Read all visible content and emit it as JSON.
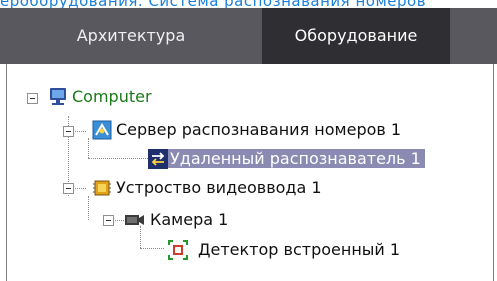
{
  "top_link": "ероборудования. Система распознавания номеров",
  "tabs": [
    {
      "label": "Архитектура",
      "active": false
    },
    {
      "label": "Оборудование",
      "active": true
    }
  ],
  "tree": {
    "root": {
      "label": "Computer",
      "icon": "computer-icon"
    },
    "server": {
      "label": "Сервер распознавания номеров 1",
      "icon": "recognition-server-icon"
    },
    "remote": {
      "label": "Удаленный распознаватель 1",
      "icon": "remote-recognizer-icon",
      "selected": true
    },
    "video_device": {
      "label": "Устроство видеоввода 1",
      "icon": "video-input-device-icon"
    },
    "camera": {
      "label": "Камера 1",
      "icon": "camera-icon"
    },
    "detector": {
      "label": "Детектор встроенный 1",
      "icon": "detector-icon"
    }
  },
  "colors": {
    "tab_bar": "#58585e",
    "tab_active": "#2e2e33",
    "selection": "#8a8ab2",
    "root_text": "#1a7a1a",
    "link": "#1a7fd8"
  }
}
